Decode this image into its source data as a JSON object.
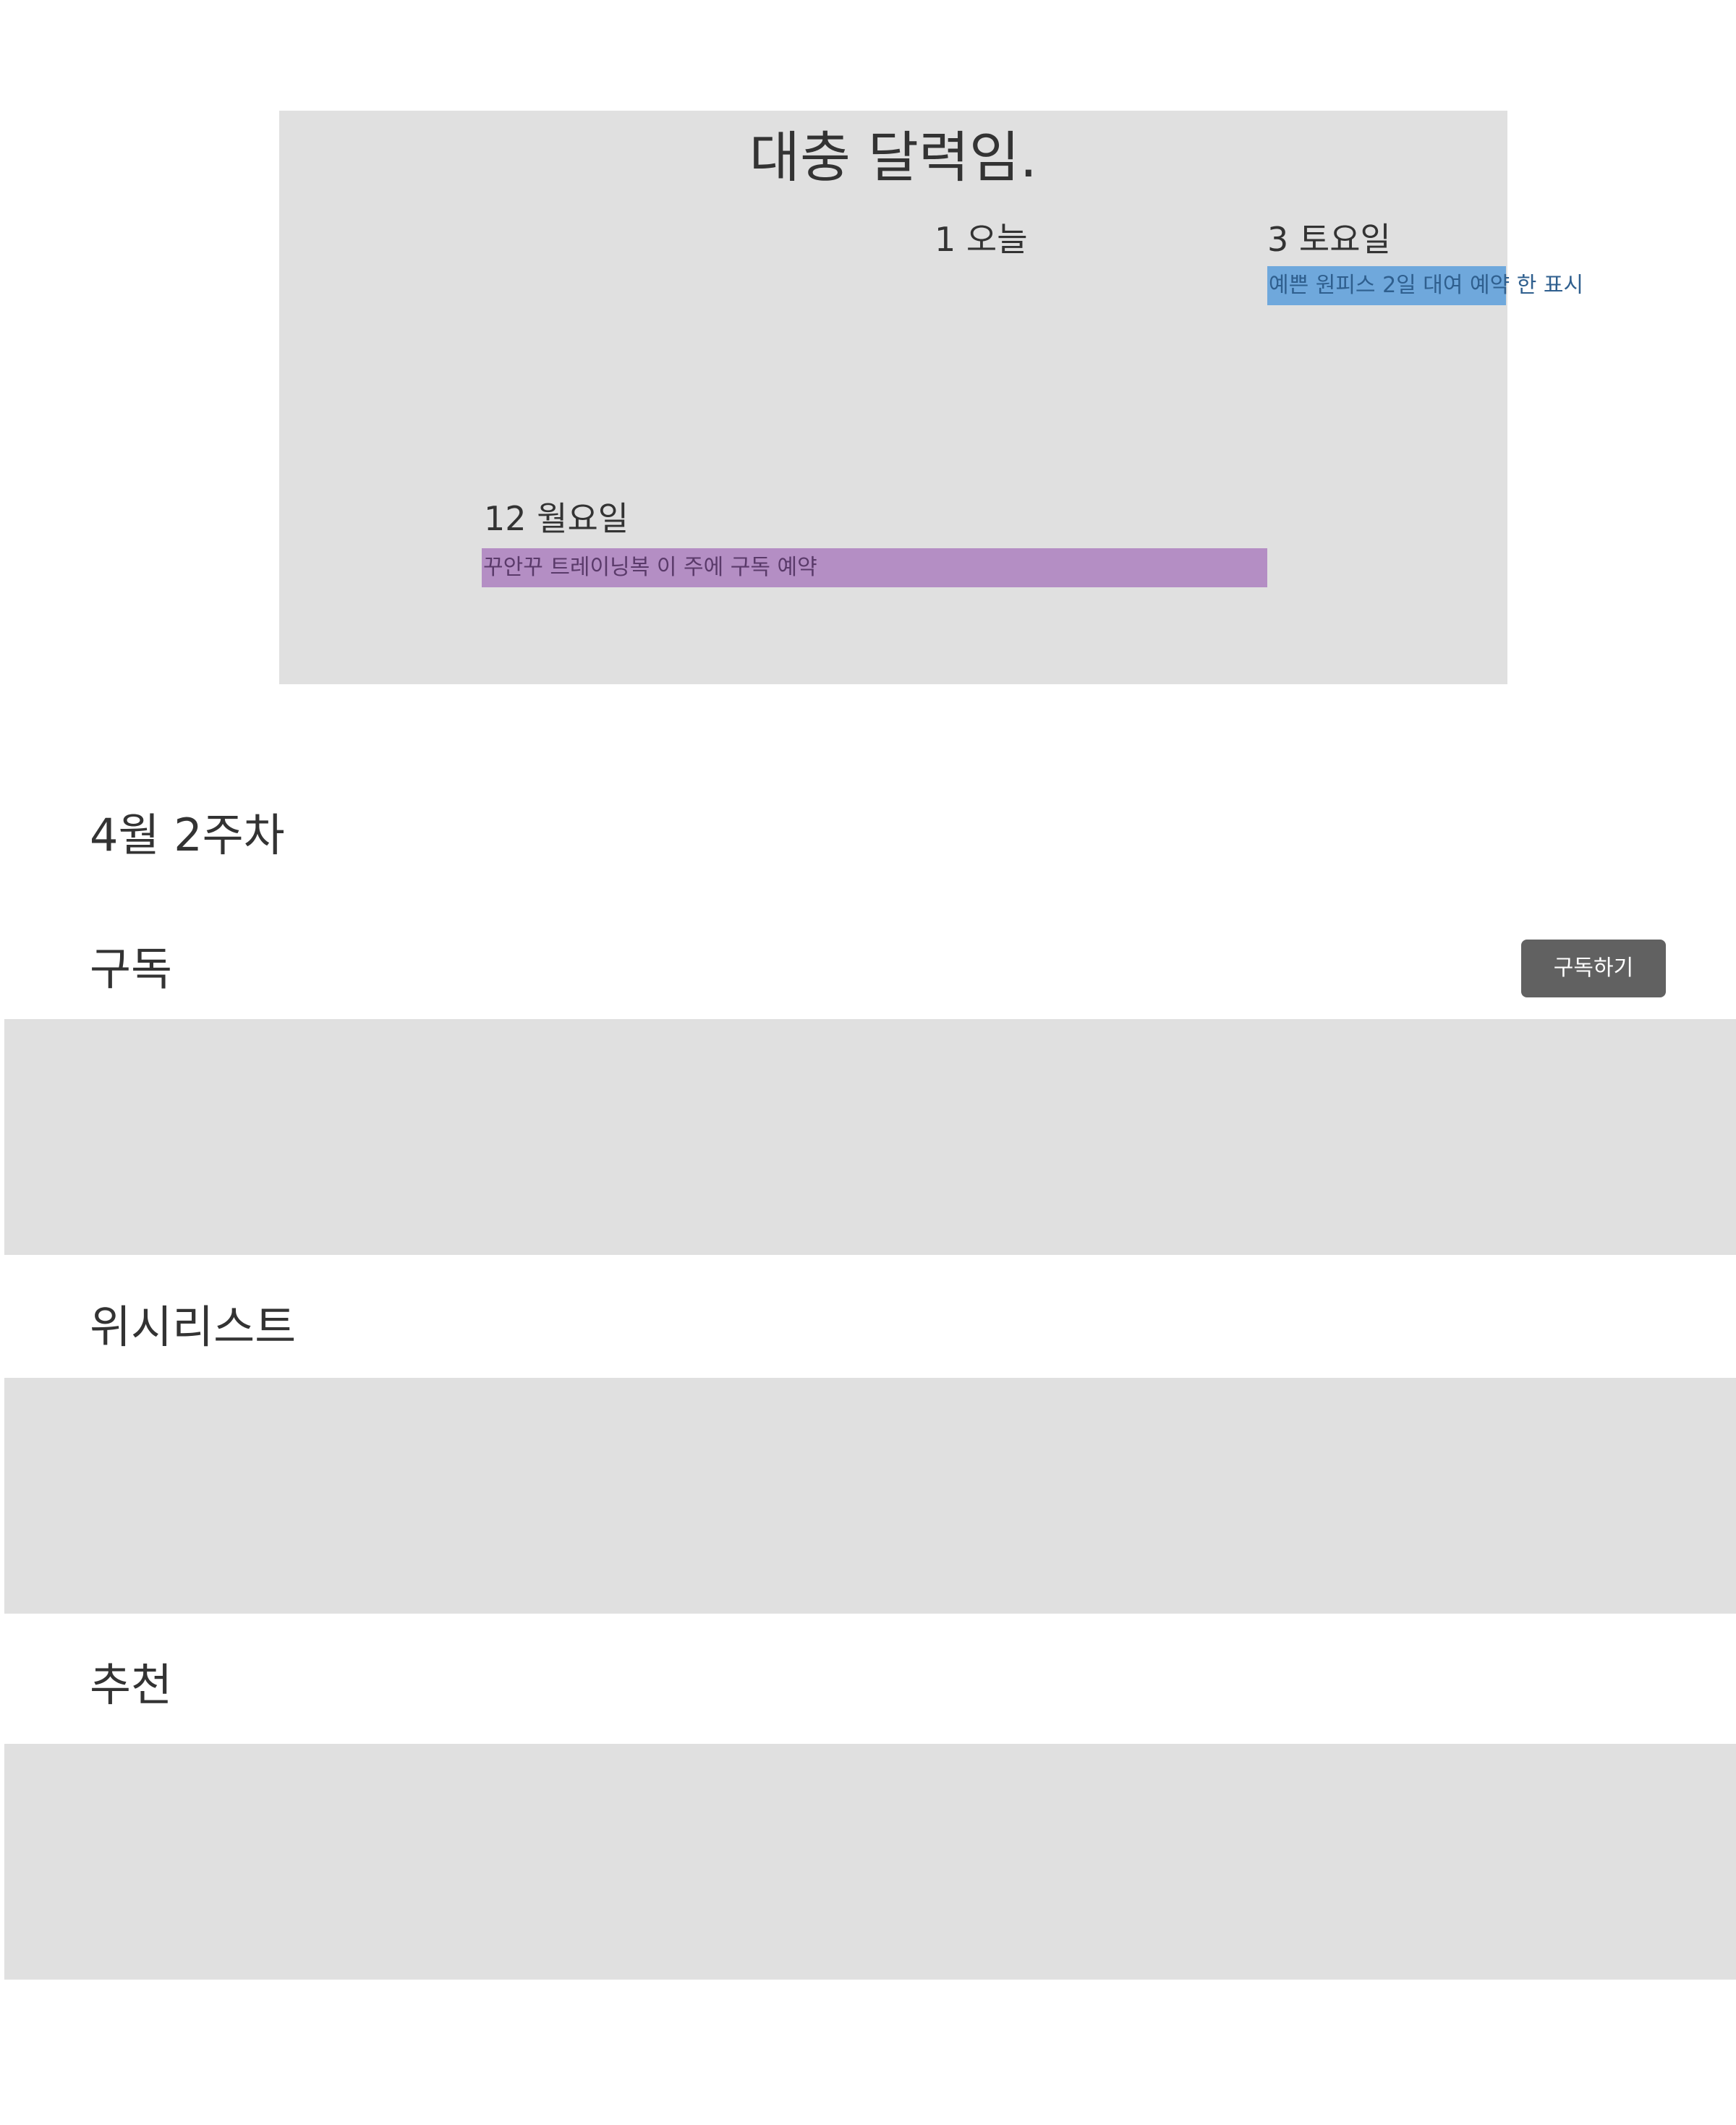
{
  "calendar": {
    "title": "대충 달력임.",
    "days": [
      {
        "label": "1 오늘"
      },
      {
        "label": "3 토요일"
      },
      {
        "label": "12 월요일"
      }
    ],
    "events": [
      {
        "text": "예쁜 원피스 2일 대여 예약 한 표시",
        "color": "#6fa8dc"
      },
      {
        "text": "꾸안꾸 트레이닝복 이 주에 구독 예약",
        "color": "#b48ec4"
      }
    ]
  },
  "week": {
    "title": "4월 2주차"
  },
  "sections": {
    "subscription": {
      "title": "구독",
      "button_label": "구독하기"
    },
    "wishlist": {
      "title": "위시리스트"
    },
    "recommend": {
      "title": "추천"
    }
  }
}
